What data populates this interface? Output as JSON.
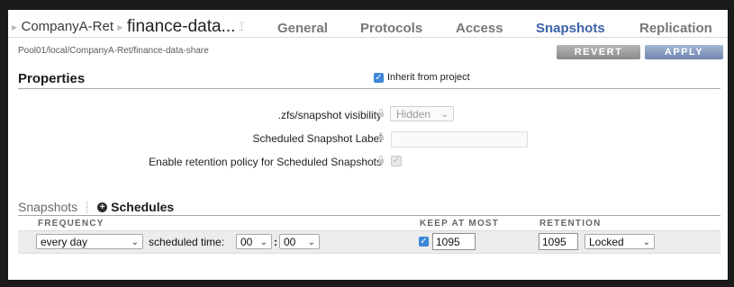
{
  "breadcrumb": {
    "project": "CompanyA-Ret",
    "share": "finance-data..."
  },
  "tabs": [
    {
      "label": "General"
    },
    {
      "label": "Protocols"
    },
    {
      "label": "Access"
    },
    {
      "label": "Snapshots",
      "active": true
    },
    {
      "label": "Replication"
    }
  ],
  "path": "Pool01/local/CompanyA-Ret/finance-data-share",
  "buttons": {
    "revert": "REVERT",
    "apply": "APPLY"
  },
  "properties": {
    "title": "Properties",
    "inherit_label": "Inherit from project",
    "inherit_checked": true,
    "zfs_visibility_label": ".zfs/snapshot visibility",
    "zfs_visibility_value": "Hidden",
    "scheduled_label": "Scheduled Snapshot Label",
    "scheduled_value": "",
    "retention_policy_label": "Enable retention policy for Scheduled Snapshots",
    "retention_policy_checked": true
  },
  "subtabs": {
    "snapshots": "Snapshots",
    "schedules": "Schedules"
  },
  "columns": {
    "frequency": "FREQUENCY",
    "keep": "KEEP AT MOST",
    "retention": "RETENTION"
  },
  "schedule_row": {
    "frequency": "every day",
    "time_label": "scheduled time:",
    "hour": "00",
    "minute": "00",
    "keep_checked": true,
    "keep_value": "1095",
    "retention_value": "1095",
    "retention_lock": "Locked"
  },
  "colors": {
    "accent": "#3a63a8",
    "checkbox": "#3b87d6",
    "apply": "#6f86b1",
    "revert": "#8a8a8a"
  },
  "icons": [
    "chevron-right-icon",
    "text-cursor-icon",
    "lock-icon",
    "checkbox-icon",
    "chevron-down-icon",
    "plus-circle-icon"
  ]
}
